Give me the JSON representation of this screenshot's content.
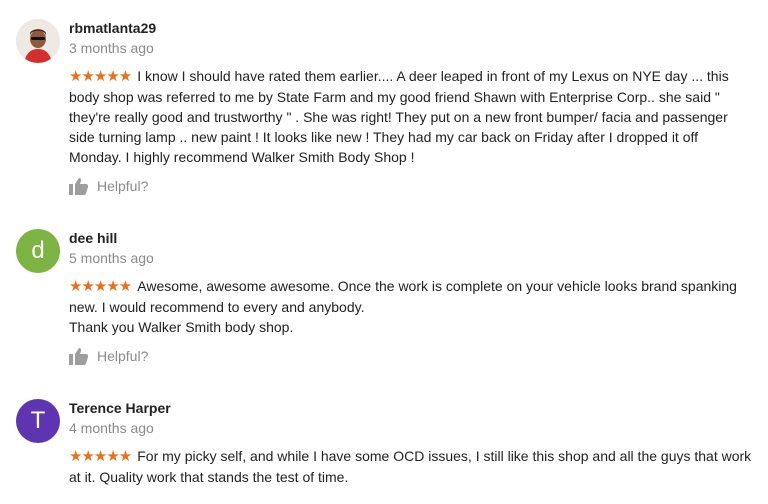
{
  "reviews": [
    {
      "author": "rbmatlanta29",
      "time": "3 months ago",
      "stars": "★★★★★",
      "rating": 5,
      "text": "I know I should have rated them earlier.... A deer leaped in front of my Lexus on NYE day ... this body shop was referred to me by State Farm and my good friend Shawn with Enterprise Corp.. she said \" they're really good and trustworthy \" . She was right! They put on a new front bumper/ facia and passenger side turning lamp .. new paint ! It looks like new ! They had my car back on Friday after I dropped it off Monday. I highly recommend Walker Smith Body Shop !",
      "helpful_label": "Helpful?"
    },
    {
      "author": "dee hill",
      "time": "5 months ago",
      "avatar_letter": "d",
      "avatar_color": "#7cb342",
      "stars": "★★★★★",
      "rating": 5,
      "text": "Awesome, awesome awesome. Once the work is complete on your vehicle looks brand spanking new. I would recommend to every and anybody.",
      "text2": "Thank you Walker Smith body shop.",
      "helpful_label": "Helpful?"
    },
    {
      "author": "Terence Harper",
      "time": "4 months ago",
      "avatar_letter": "T",
      "avatar_color": "#5e35b1",
      "stars": "★★★★★",
      "rating": 5,
      "text": "For my picky self,  and while I have some OCD issues, I still like this shop and all the guys that work at it. Quality work that stands the test of time."
    }
  ],
  "colors": {
    "star": "#e7711b",
    "muted": "#8a8a8a"
  }
}
